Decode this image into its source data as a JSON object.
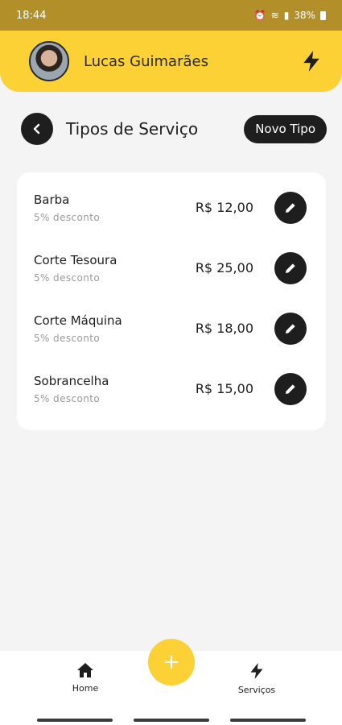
{
  "status_bar": {
    "time": "18:44",
    "battery": "38%"
  },
  "header": {
    "user_name": "Lucas Guimarães"
  },
  "page": {
    "title": "Tipos de Serviço",
    "new_button": "Novo Tipo"
  },
  "services": [
    {
      "name": "Barba",
      "discount": "5% desconto",
      "price": "R$ 12,00"
    },
    {
      "name": "Corte Tesoura",
      "discount": "5% desconto",
      "price": "R$ 25,00"
    },
    {
      "name": "Corte Máquina",
      "discount": "5% desconto",
      "price": "R$ 18,00"
    },
    {
      "name": "Sobrancelha",
      "discount": "5% desconto",
      "price": "R$ 15,00"
    }
  ],
  "bottom_nav": {
    "home_label": "Home",
    "services_label": "Serviços",
    "fab_label": "+"
  },
  "colors": {
    "accent": "#fcd136",
    "dark": "#1e1e1e",
    "status_bar": "#b38f2a"
  },
  "icons": {
    "back": "chevron-left-icon",
    "edit": "pencil-icon",
    "bolt": "bolt-icon",
    "home": "home-icon",
    "add": "plus-icon"
  }
}
